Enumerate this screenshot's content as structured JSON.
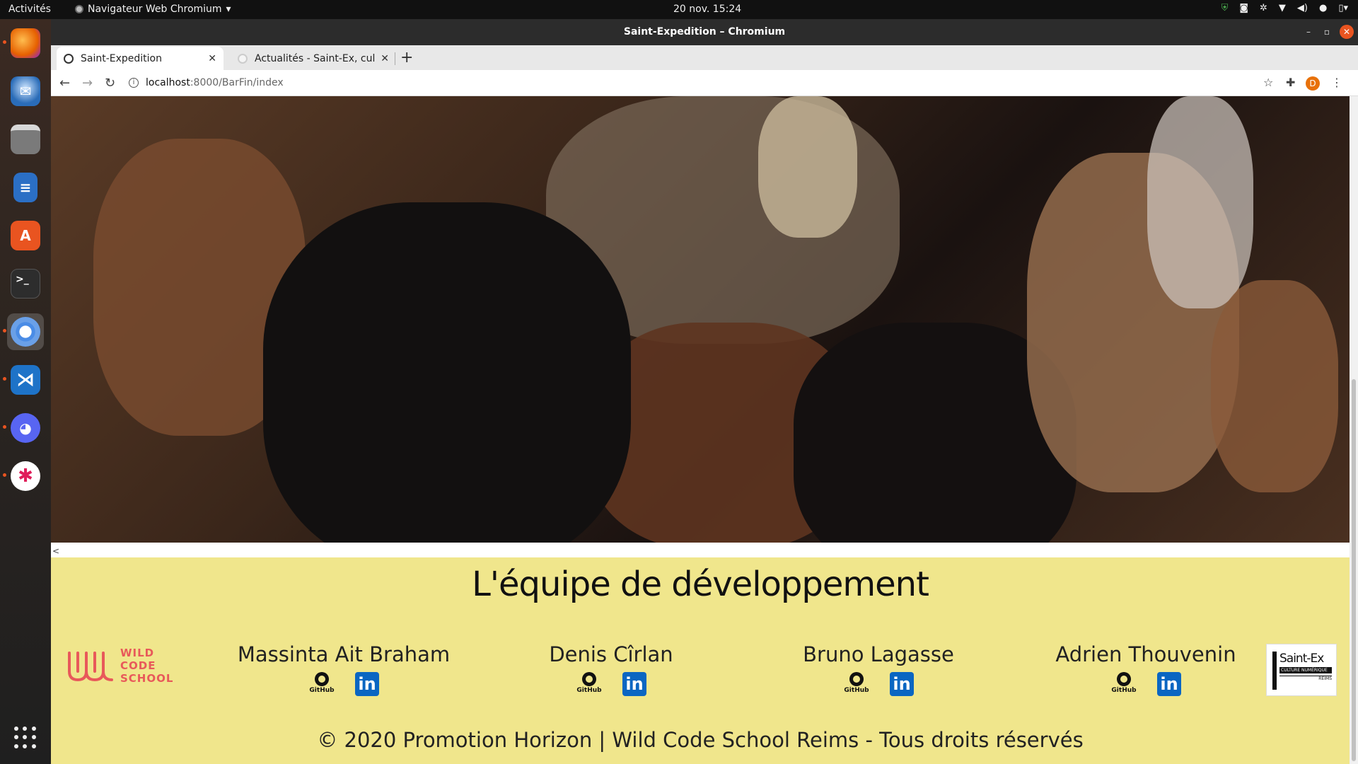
{
  "topbar": {
    "activities": "Activités",
    "app_menu": "Navigateur Web Chromium",
    "clock": "20 nov.  15:24"
  },
  "dock": {
    "items": [
      {
        "name": "firefox",
        "color": "#e66000"
      },
      {
        "name": "thunderbird",
        "color": "#2a6cb8"
      },
      {
        "name": "files",
        "color": "#6e6e6e"
      },
      {
        "name": "libreoffice-writer",
        "color": "#2b6fc5"
      },
      {
        "name": "ubuntu-software",
        "color": "#e95420"
      },
      {
        "name": "terminal",
        "color": "#2d2d2d"
      },
      {
        "name": "chromium",
        "color": "#4a8ce6"
      },
      {
        "name": "vscode",
        "color": "#1e73c8"
      },
      {
        "name": "discord",
        "color": "#5865f2"
      },
      {
        "name": "slack",
        "color": "#ffffff"
      }
    ]
  },
  "window": {
    "title": "Saint-Expedition – Chromium"
  },
  "tabs": [
    {
      "label": "Saint-Expedition",
      "active": true
    },
    {
      "label": "Actualités - Saint-Ex, cultu",
      "active": false
    }
  ],
  "toolbar": {
    "url_host": "localhost",
    "url_path": ":8000/BarFin/index",
    "profile_initial": "D"
  },
  "carousel": {
    "prev_label": "<"
  },
  "footer": {
    "team_title": "L'équipe de développement",
    "wcs_logo": [
      "WILD",
      "CODE",
      "SCHOOL"
    ],
    "members": [
      {
        "name": "Massinta Ait Braham"
      },
      {
        "name": "Denis Cîrlan"
      },
      {
        "name": "Bruno Lagasse"
      },
      {
        "name": "Adrien Thouvenin"
      }
    ],
    "github_label": "GitHub",
    "linkedin_label": "in",
    "saintex_logo": {
      "title": "Saint-Ex",
      "subtitle": "CULTURE NUMÉRIQUE",
      "city": "REIMS"
    },
    "copyright": "© 2020 Promotion Horizon | Wild Code School Reims - Tous droits réservés"
  },
  "colors": {
    "footer_bg": "#f0e68c",
    "linkedin": "#0a66c2",
    "wcs": "#e8595a",
    "ubuntu_accent": "#e95420"
  }
}
